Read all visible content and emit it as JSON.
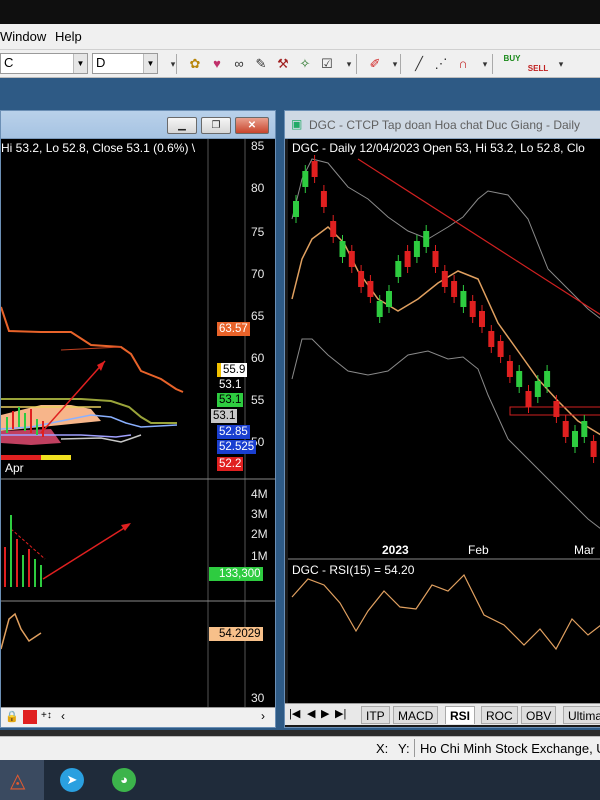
{
  "menu": {
    "window": "Window",
    "help": "Help"
  },
  "toolbar": {
    "symbol": "C",
    "interval": "D",
    "buy": "BUY",
    "sell": "SELL"
  },
  "left_chart": {
    "header": "Hi 53.2, Lo 52.8, Close 53.1 (0.6%) \\",
    "yaxis_price": [
      "85",
      "80",
      "75",
      "70",
      "65",
      "60",
      "55",
      "50"
    ],
    "tags": [
      {
        "text": "63.57",
        "bg": "#e8632a",
        "fg": "#ffffff"
      },
      {
        "text": "55.9",
        "bg": "#ffffff",
        "fg": "#000000",
        "accent": "#f0c000"
      },
      {
        "text": "53.1",
        "bg": "#000000",
        "fg": "#ffffff"
      },
      {
        "text": "53.1",
        "bg": "#2ecc40",
        "fg": "#000000"
      },
      {
        "text": "53.1",
        "bg": "#c8c8c8",
        "fg": "#000000"
      },
      {
        "text": "52.85",
        "bg": "#1a3fd0",
        "fg": "#ffffff"
      },
      {
        "text": "52.525",
        "bg": "#1a3fd0",
        "fg": "#ffffff"
      },
      {
        "text": "52.2",
        "bg": "#e02020",
        "fg": "#ffffff"
      }
    ],
    "xlabel": "Apr",
    "yaxis_volume": [
      "4M",
      "3M",
      "2M",
      "1M"
    ],
    "volume_tag": "133,300",
    "rsi_tag": "54.2029",
    "rsi_axis": "30"
  },
  "right_chart": {
    "window_title": "DGC - CTCP Tap doan Hoa chat Duc Giang - Daily",
    "header": "DGC - Daily 12/04/2023  Open 53, Hi 53.2, Lo 52.8, Clo",
    "xlabels": [
      "2023",
      "Feb",
      "Mar"
    ],
    "rsi_label": "DGC - RSI(15) = 54.20",
    "tabs": [
      "ITP",
      "MACD",
      "RSI",
      "ROC",
      "OBV",
      "Ultima"
    ]
  },
  "status": {
    "x": "X:",
    "y": "Y:",
    "exchange": "Ho Chi Minh Stock Exchange, Un"
  },
  "colors": {
    "up": "#2ecc40",
    "down": "#e02020",
    "band": "#9a9a9a",
    "ma": "#e0a060",
    "trend": "#d02020",
    "accent": "#e8632a"
  }
}
